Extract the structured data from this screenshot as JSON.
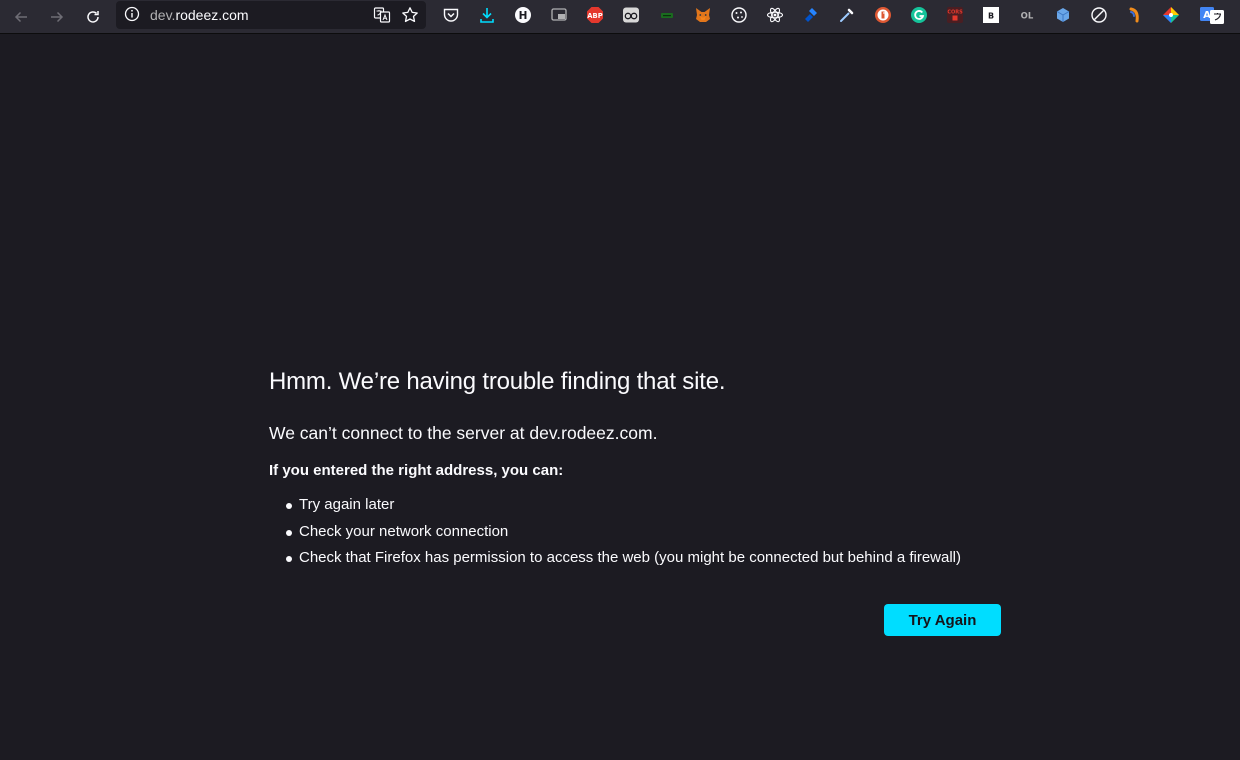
{
  "browser": {
    "url_host": "dev.",
    "url_domain": "rodeez.com",
    "colors": {
      "toolbar": "#2b2a33",
      "page": "#1c1b22",
      "accent": "#00ddff"
    }
  },
  "extensions": [
    {
      "name": "pocket-icon"
    },
    {
      "name": "download-icon"
    },
    {
      "name": "h-extension-icon",
      "text": "H"
    },
    {
      "name": "picture-in-picture-icon"
    },
    {
      "name": "adblock-plus-icon",
      "text": "ABP"
    },
    {
      "name": "eyeglasses-icon"
    },
    {
      "name": "green-extension-icon"
    },
    {
      "name": "metamask-fox-icon"
    },
    {
      "name": "cookie-icon"
    },
    {
      "name": "react-devtools-icon"
    },
    {
      "name": "jira-icon"
    },
    {
      "name": "color-picker-icon"
    },
    {
      "name": "duckduckgo-icon"
    },
    {
      "name": "grammarly-icon"
    },
    {
      "name": "corsi-icon",
      "text": "CORS"
    },
    {
      "name": "b-extension-icon",
      "text": "B"
    },
    {
      "name": "ol-extension-icon",
      "text": "OL"
    },
    {
      "name": "cube-icon"
    },
    {
      "name": "block-icon"
    },
    {
      "name": "orange-swoosh-icon"
    },
    {
      "name": "colorful-gem-icon"
    },
    {
      "name": "translate-extension-icon",
      "text": "A"
    }
  ],
  "error": {
    "title": "Hmm. We’re having trouble finding that site.",
    "description": "We can’t connect to the server at dev.rodeez.com.",
    "lead": "If you entered the right address, you can:",
    "items": [
      "Try again later",
      "Check your network connection",
      "Check that Firefox has permission to access the web (you might be connected but behind a firewall)"
    ],
    "button": "Try Again"
  }
}
